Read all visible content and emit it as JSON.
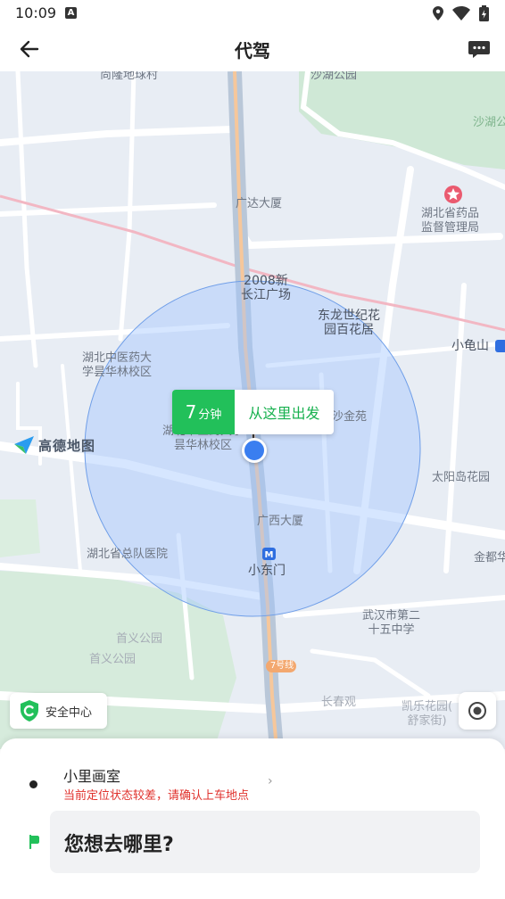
{
  "status_bar": {
    "time": "10:09",
    "notification_icon": "A"
  },
  "header": {
    "title": "代驾",
    "back_icon": "back-arrow-icon",
    "message_icon": "message-icon"
  },
  "map": {
    "labels": {
      "shanglong": "尚隆地球村",
      "top_right_park": "沙湖公",
      "top_center_park": "沙湖公园",
      "guangda": "广达大厦",
      "drug_admin": "湖北省药品\n监督管理局",
      "changjiang": "2008新\n长江广场",
      "dongsheng": "东龙世纪花\n园百花居",
      "xiaoguishan": "小龟山",
      "tcm_univ": "湖北中医药大\n学昙华林校区",
      "tcm_univ2": "湖北中医药大学\n昙华林校区",
      "shajinyuan": "沙金苑",
      "taiyangdao": "太阳岛花园",
      "guangxi": "广西大厦",
      "zongdui": "湖北省总队医院",
      "xiaodongmen": "小东门",
      "jindu": "金都华",
      "no25_school": "武汉市第二\n十五中学",
      "shouyi1": "首义公园",
      "shouyi2": "首义公园",
      "line7": "7号线",
      "changchun": "长春观",
      "kaile": "凯乐花园(\n舒家街)"
    },
    "pickup": {
      "eta_num": "7",
      "eta_unit": "分钟",
      "action": "从这里出发"
    },
    "brand_logo": "高德地图",
    "safety_center": "安全中心",
    "locate_icon": "locate-icon"
  },
  "trip": {
    "start_name": "小里画室",
    "start_warning": "当前定位状态较差，请确认上车地点",
    "destination_placeholder": "您想去哪里?"
  },
  "colors": {
    "accent_green": "#22c05a",
    "warning_red": "#e0312c",
    "pickup_circle": "#3a7ef0"
  }
}
